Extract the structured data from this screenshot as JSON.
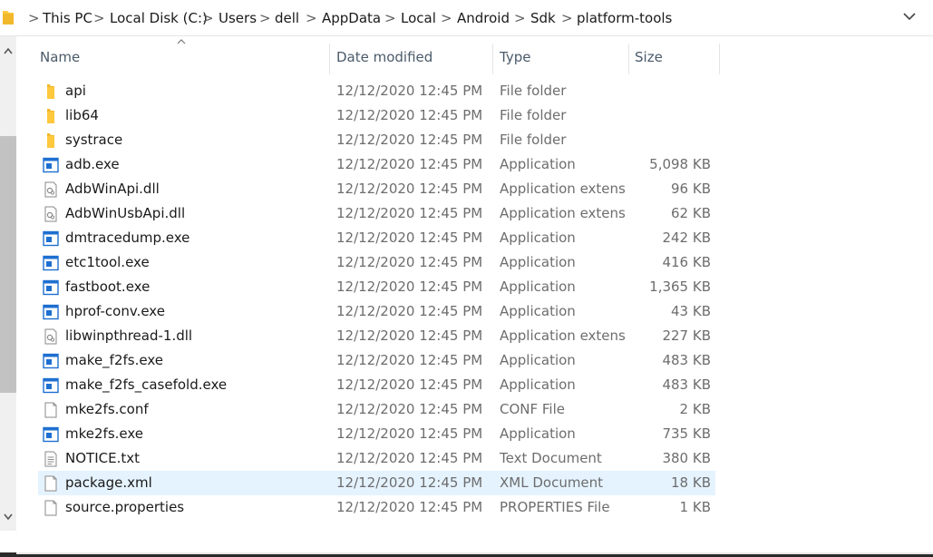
{
  "address_bar": {
    "segments": [
      "This PC",
      "Local Disk (C:)",
      "Users",
      "dell",
      "AppData",
      "Local",
      "Android",
      "Sdk",
      "platform-tools"
    ],
    "separator": ">"
  },
  "columns": {
    "name": "Name",
    "date": "Date modified",
    "type": "Type",
    "size": "Size",
    "sorted_by": "Name"
  },
  "files": [
    {
      "name": "api",
      "date": "12/12/2020 12:45 PM",
      "type": "File folder",
      "size": "",
      "icon": "folder-icon"
    },
    {
      "name": "lib64",
      "date": "12/12/2020 12:45 PM",
      "type": "File folder",
      "size": "",
      "icon": "folder-icon"
    },
    {
      "name": "systrace",
      "date": "12/12/2020 12:45 PM",
      "type": "File folder",
      "size": "",
      "icon": "folder-icon"
    },
    {
      "name": "adb.exe",
      "date": "12/12/2020 12:45 PM",
      "type": "Application",
      "size": "5,098 KB",
      "icon": "application-icon"
    },
    {
      "name": "AdbWinApi.dll",
      "date": "12/12/2020 12:45 PM",
      "type": "Application extens...",
      "size": "96 KB",
      "icon": "dll-icon"
    },
    {
      "name": "AdbWinUsbApi.dll",
      "date": "12/12/2020 12:45 PM",
      "type": "Application extens...",
      "size": "62 KB",
      "icon": "dll-icon"
    },
    {
      "name": "dmtracedump.exe",
      "date": "12/12/2020 12:45 PM",
      "type": "Application",
      "size": "242 KB",
      "icon": "application-icon"
    },
    {
      "name": "etc1tool.exe",
      "date": "12/12/2020 12:45 PM",
      "type": "Application",
      "size": "416 KB",
      "icon": "application-icon"
    },
    {
      "name": "fastboot.exe",
      "date": "12/12/2020 12:45 PM",
      "type": "Application",
      "size": "1,365 KB",
      "icon": "application-icon"
    },
    {
      "name": "hprof-conv.exe",
      "date": "12/12/2020 12:45 PM",
      "type": "Application",
      "size": "43 KB",
      "icon": "application-icon"
    },
    {
      "name": "libwinpthread-1.dll",
      "date": "12/12/2020 12:45 PM",
      "type": "Application extens...",
      "size": "227 KB",
      "icon": "dll-icon"
    },
    {
      "name": "make_f2fs.exe",
      "date": "12/12/2020 12:45 PM",
      "type": "Application",
      "size": "483 KB",
      "icon": "application-icon"
    },
    {
      "name": "make_f2fs_casefold.exe",
      "date": "12/12/2020 12:45 PM",
      "type": "Application",
      "size": "483 KB",
      "icon": "application-icon"
    },
    {
      "name": "mke2fs.conf",
      "date": "12/12/2020 12:45 PM",
      "type": "CONF File",
      "size": "2 KB",
      "icon": "blank-file-icon"
    },
    {
      "name": "mke2fs.exe",
      "date": "12/12/2020 12:45 PM",
      "type": "Application",
      "size": "735 KB",
      "icon": "application-icon"
    },
    {
      "name": "NOTICE.txt",
      "date": "12/12/2020 12:45 PM",
      "type": "Text Document",
      "size": "380 KB",
      "icon": "text-file-icon"
    },
    {
      "name": "package.xml",
      "date": "12/12/2020 12:45 PM",
      "type": "XML Document",
      "size": "18 KB",
      "icon": "blank-file-icon",
      "selected": true
    },
    {
      "name": "source.properties",
      "date": "12/12/2020 12:45 PM",
      "type": "PROPERTIES File",
      "size": "1 KB",
      "icon": "blank-file-icon"
    }
  ],
  "colors": {
    "selection": "#e5f3ff",
    "folder": "#ffc83d",
    "app_icon_blue": "#1e6fd0"
  }
}
